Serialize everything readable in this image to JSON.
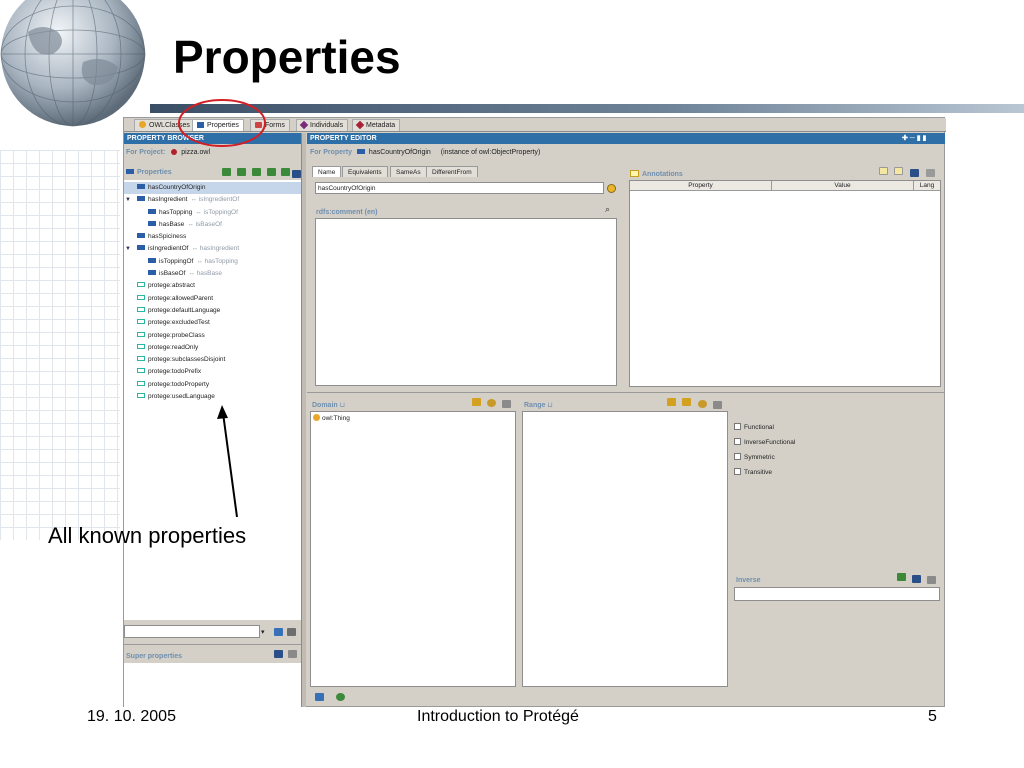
{
  "slide": {
    "title": "Properties",
    "annotation": "All known properties",
    "footer_date": "19. 10. 2005",
    "footer_title": "Introduction to Protégé",
    "page_number": "5"
  },
  "app": {
    "tabs": [
      {
        "label": "OWLClasses",
        "icon": "circle-icon",
        "active": false
      },
      {
        "label": "Properties",
        "icon": "property-icon",
        "active": true
      },
      {
        "label": "Forms",
        "icon": "form-icon",
        "active": false
      },
      {
        "label": "Individuals",
        "icon": "diamond-icon",
        "active": false
      },
      {
        "label": "Metadata",
        "icon": "diamond-icon",
        "active": false
      }
    ],
    "browser": {
      "header": "PROPERTY BROWSER",
      "project_label": "For Project:",
      "project_value": "pizza.owl",
      "properties_label": "Properties",
      "items": [
        {
          "label": "hasCountryOfOrigin",
          "inverse": "",
          "kind": "object",
          "indent": 0,
          "expanded": false,
          "selected": true
        },
        {
          "label": "hasIngredient",
          "inverse": "↔ isIngredientOf",
          "kind": "object",
          "indent": 0,
          "expanded": true,
          "selected": false
        },
        {
          "label": "hasTopping",
          "inverse": "↔ isToppingOf",
          "kind": "object",
          "indent": 1,
          "expanded": false,
          "selected": false
        },
        {
          "label": "hasBase",
          "inverse": "↔ isBaseOf",
          "kind": "object",
          "indent": 1,
          "expanded": false,
          "selected": false
        },
        {
          "label": "hasSpiciness",
          "inverse": "",
          "kind": "object",
          "indent": 0,
          "expanded": false,
          "selected": false
        },
        {
          "label": "isIngredientOf",
          "inverse": "↔ hasIngredient",
          "kind": "object",
          "indent": 0,
          "expanded": true,
          "selected": false
        },
        {
          "label": "isToppingOf",
          "inverse": "↔ hasTopping",
          "kind": "object",
          "indent": 1,
          "expanded": false,
          "selected": false
        },
        {
          "label": "isBaseOf",
          "inverse": "↔ hasBase",
          "kind": "object",
          "indent": 1,
          "expanded": false,
          "selected": false
        },
        {
          "label": "protege:abstract",
          "inverse": "",
          "kind": "annotation",
          "indent": 0,
          "expanded": false,
          "selected": false
        },
        {
          "label": "protege:allowedParent",
          "inverse": "",
          "kind": "annotation",
          "indent": 0,
          "expanded": false,
          "selected": false
        },
        {
          "label": "protege:defaultLanguage",
          "inverse": "",
          "kind": "annotation",
          "indent": 0,
          "expanded": false,
          "selected": false
        },
        {
          "label": "protege:excludedTest",
          "inverse": "",
          "kind": "annotation",
          "indent": 0,
          "expanded": false,
          "selected": false
        },
        {
          "label": "protege:probeClass",
          "inverse": "",
          "kind": "annotation",
          "indent": 0,
          "expanded": false,
          "selected": false
        },
        {
          "label": "protege:readOnly",
          "inverse": "",
          "kind": "annotation",
          "indent": 0,
          "expanded": false,
          "selected": false
        },
        {
          "label": "protege:subclassesDisjoint",
          "inverse": "",
          "kind": "annotation",
          "indent": 0,
          "expanded": false,
          "selected": false
        },
        {
          "label": "protege:todoPrefix",
          "inverse": "",
          "kind": "annotation",
          "indent": 0,
          "expanded": false,
          "selected": false
        },
        {
          "label": "protege:todoProperty",
          "inverse": "",
          "kind": "annotation",
          "indent": 0,
          "expanded": false,
          "selected": false
        },
        {
          "label": "protege:usedLanguage",
          "inverse": "",
          "kind": "annotation",
          "indent": 0,
          "expanded": false,
          "selected": false
        }
      ],
      "super_properties_label": "Super properties"
    },
    "editor": {
      "header": "PROPERTY EDITOR",
      "for_property_label": "For Property",
      "for_property_value": "hasCountryOfOrigin",
      "instance_text": "(instance of owl:ObjectProperty)",
      "tabs": [
        "Name",
        "Equivalents",
        "SameAs",
        "DifferentFrom"
      ],
      "name_value": "hasCountryOfOrigin",
      "comment_label": "rdfs:comment (en)",
      "annotations_label": "Annotations",
      "annotation_columns": [
        "Property",
        "Value",
        "Lang"
      ],
      "domain_label": "Domain",
      "domain_items": [
        "owl:Thing"
      ],
      "range_label": "Range",
      "characteristics": [
        {
          "label": "Functional",
          "checked": false
        },
        {
          "label": "InverseFunctional",
          "checked": false
        },
        {
          "label": "Symmetric",
          "checked": false
        },
        {
          "label": "Transitive",
          "checked": false
        }
      ],
      "inverse_label": "Inverse"
    }
  },
  "colors": {
    "header_blue": "#2f6fa8",
    "object_property": "#2a5fa8",
    "annotation_property": "#2bb6a3",
    "highlight_circle": "#d21f26",
    "selection": "#c6d6ea"
  }
}
